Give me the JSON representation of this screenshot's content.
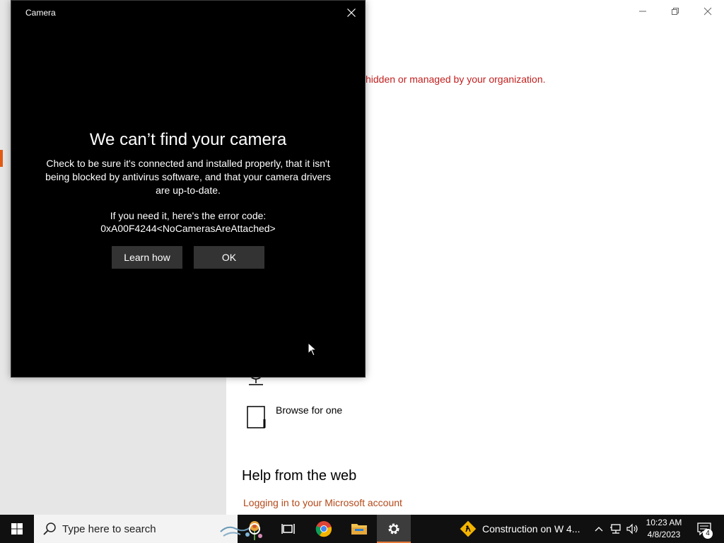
{
  "settings": {
    "org_warning": "hidden or managed by your organization.",
    "browse_label": "Browse for one",
    "help_heading": "Help from the web",
    "help_link": "Logging in to your Microsoft account"
  },
  "camera_dialog": {
    "title": "Camera",
    "heading": "We can’t find your camera",
    "body": "Check to be sure it's connected and installed properly, that it isn't being blocked by antivirus software, and that your camera drivers are up-to-date.",
    "error_code_label": "If you need it, here's the error code:",
    "error_code": "0xA00F4244<NoCamerasAreAttached>",
    "learn_how_label": "Learn how",
    "ok_label": "OK"
  },
  "taskbar": {
    "search_placeholder": "Type here to search",
    "news_text": "Construction on W 4...",
    "time": "10:23 AM",
    "date": "4/8/2023",
    "notification_count": "4"
  },
  "colors": {
    "accent_orange": "#e15a14",
    "warning_red": "#c2201f",
    "link_orange": "#b3491a",
    "dialog_bg": "#000000",
    "taskbar_bg": "#101010"
  }
}
